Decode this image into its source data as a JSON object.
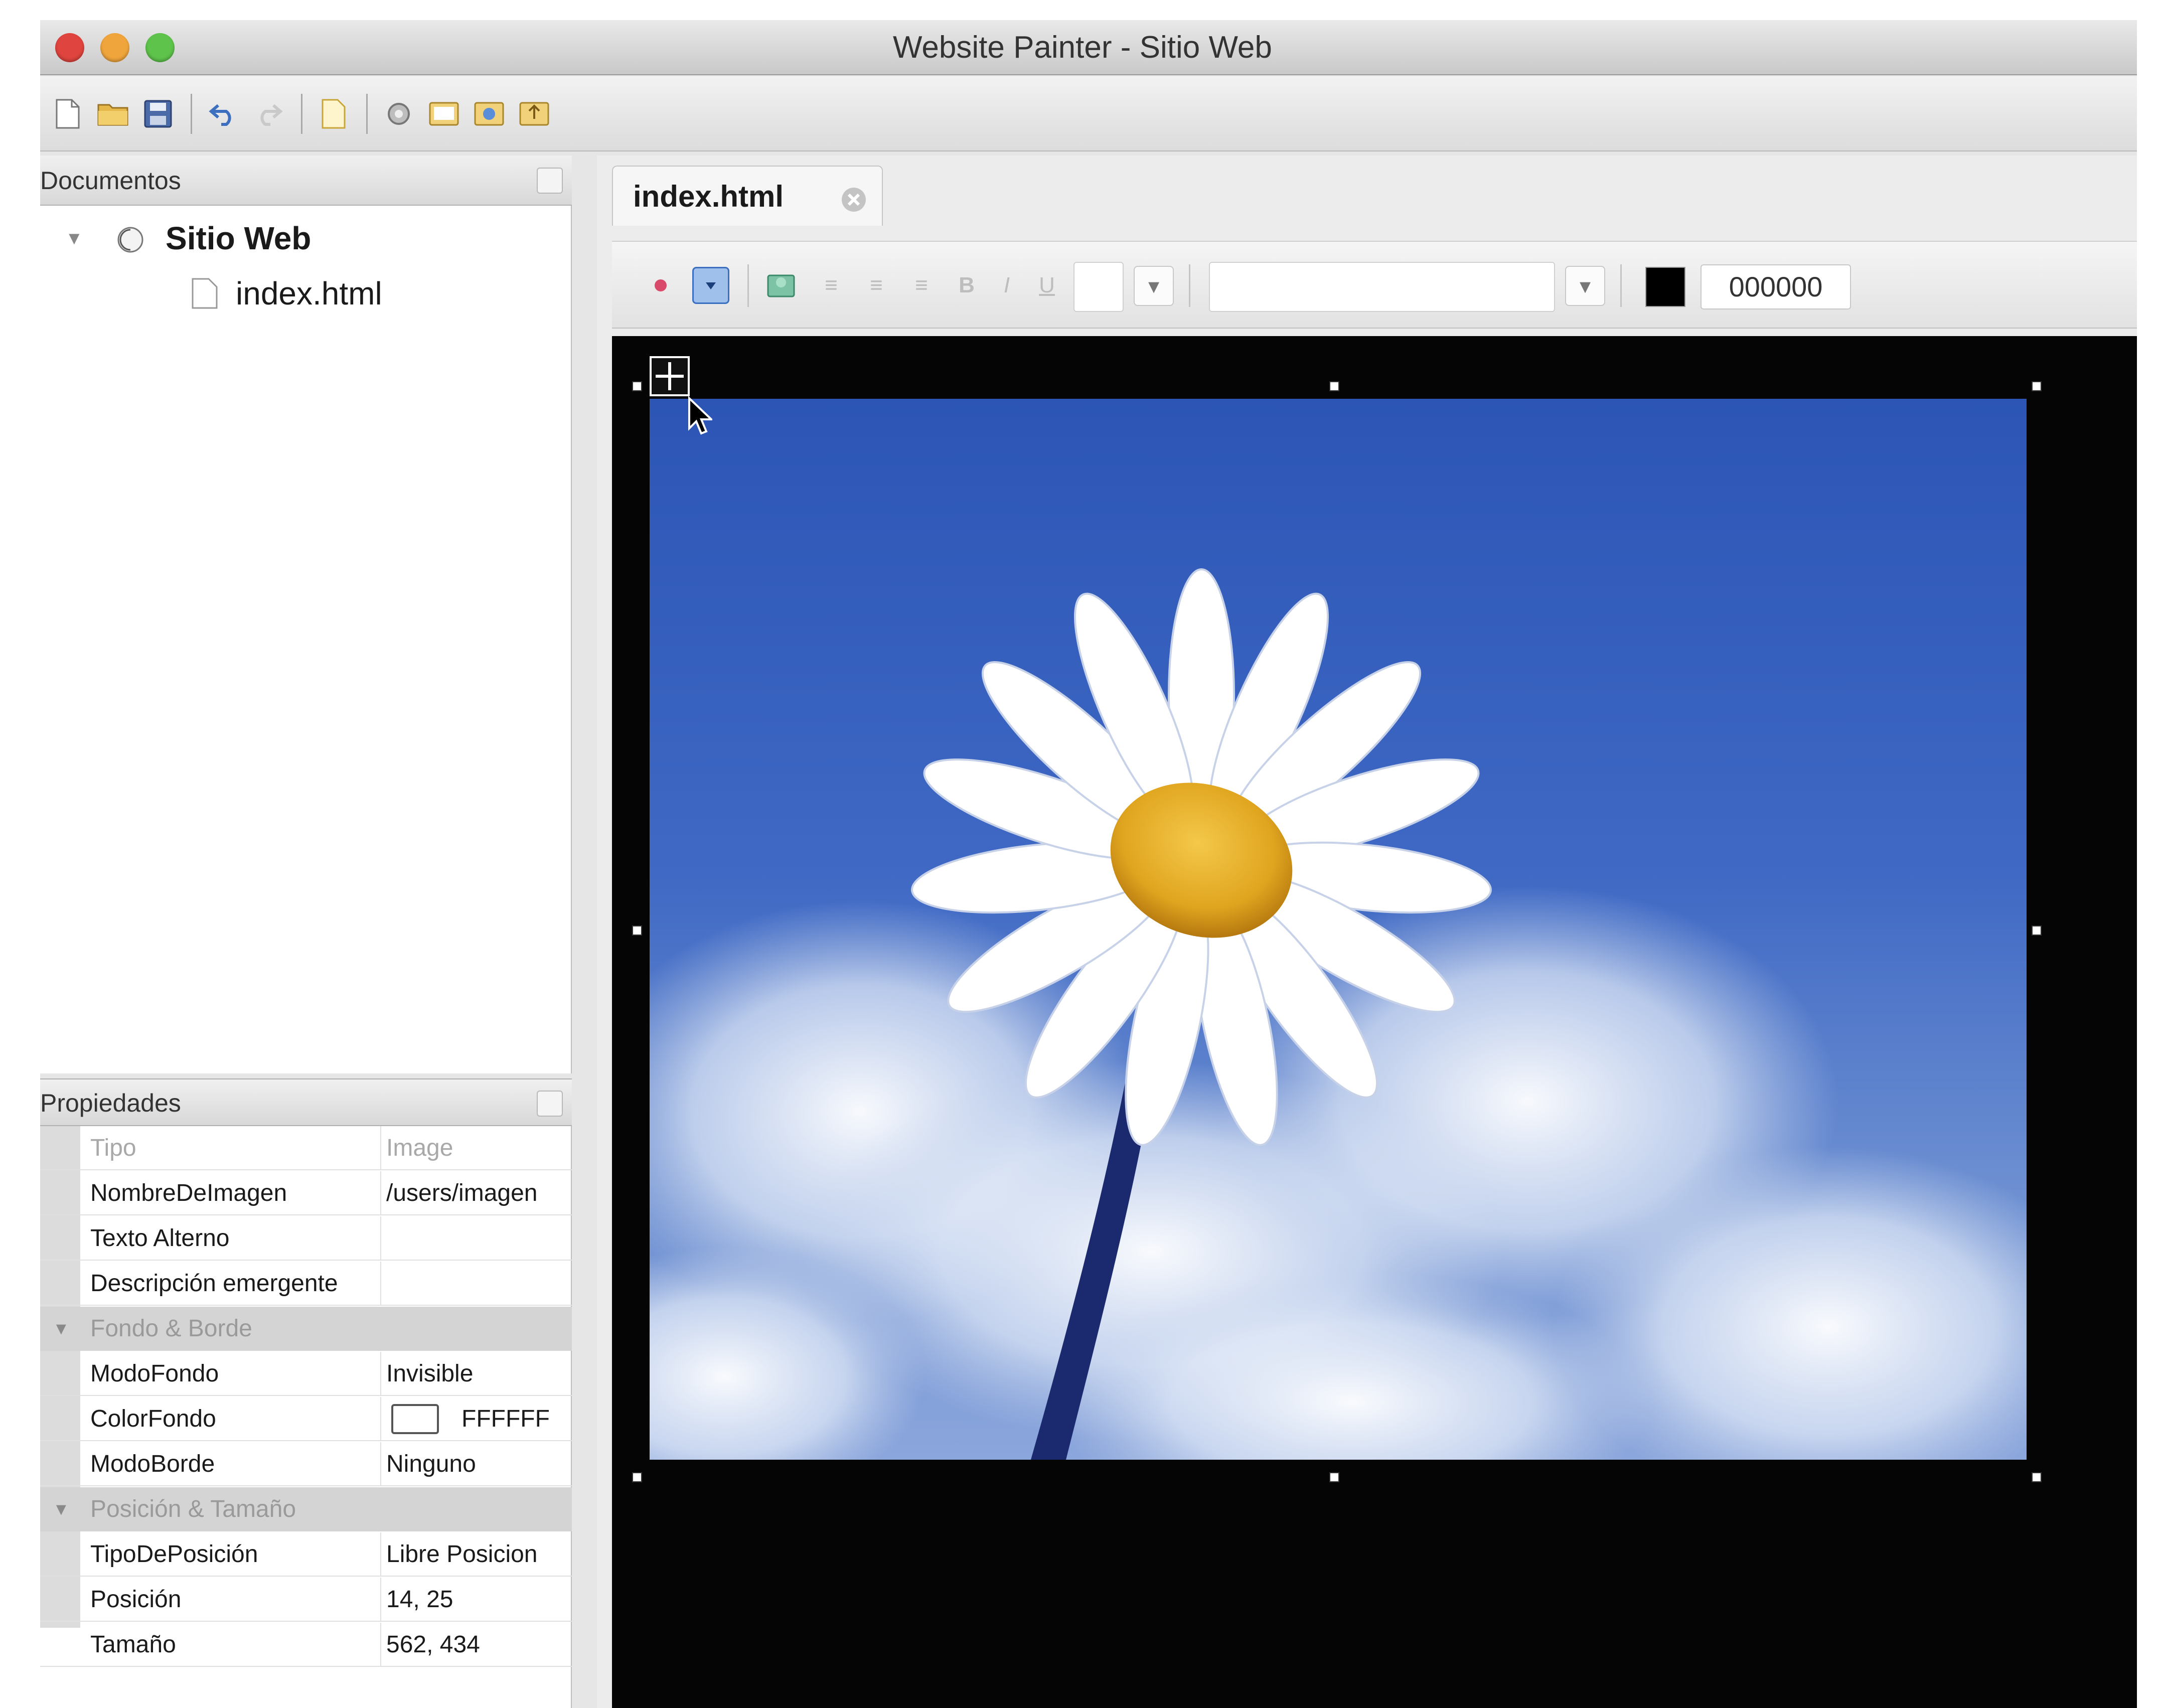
{
  "window": {
    "title": "Website Painter - Sitio Web",
    "traffic_lights": [
      "#e0443e",
      "#f0a53c",
      "#5ec34b"
    ]
  },
  "toolbar": {
    "icons": [
      "new-file-icon",
      "open-folder-icon",
      "save-icon",
      "undo-icon",
      "redo-icon",
      "page-icon",
      "settings-icon",
      "preview-icon",
      "publish-icon",
      "upload-icon"
    ]
  },
  "documents_panel": {
    "title": "Documentos",
    "tree": [
      {
        "label": "Sitio Web",
        "expanded": true
      },
      {
        "label": "index.html"
      }
    ]
  },
  "properties_panel": {
    "title": "Propiedades",
    "rows": [
      {
        "label": "Tipo",
        "value": "Image"
      },
      {
        "label": "NombreDeImagen",
        "value": "/users/imagen"
      },
      {
        "label": "Texto Alterno",
        "value": ""
      },
      {
        "label": "Descripción emergente",
        "value": ""
      }
    ],
    "category_background": "Fondo & Borde",
    "background_rows": [
      {
        "label": "ModoFondo",
        "value": "Invisible"
      },
      {
        "label": "ColorFondo",
        "value": "FFFFFF"
      },
      {
        "label": "ModoBorde",
        "value": "Ninguno"
      }
    ],
    "category_position": "Posición & Tamaño",
    "position_rows": [
      {
        "label": "TipoDePosición",
        "value": "Libre Posicion"
      },
      {
        "label": "Posición",
        "value": "14, 25"
      },
      {
        "label": "Tamaño",
        "value": "562, 434"
      }
    ]
  },
  "editor": {
    "tab_label": "index.html",
    "format_bar": {
      "font_size_value": "",
      "font_family_value": "",
      "color_hex": "000000",
      "color_swatch": "#000000"
    },
    "canvas_background": "#050505",
    "image_description_icon": "daisy-image"
  }
}
